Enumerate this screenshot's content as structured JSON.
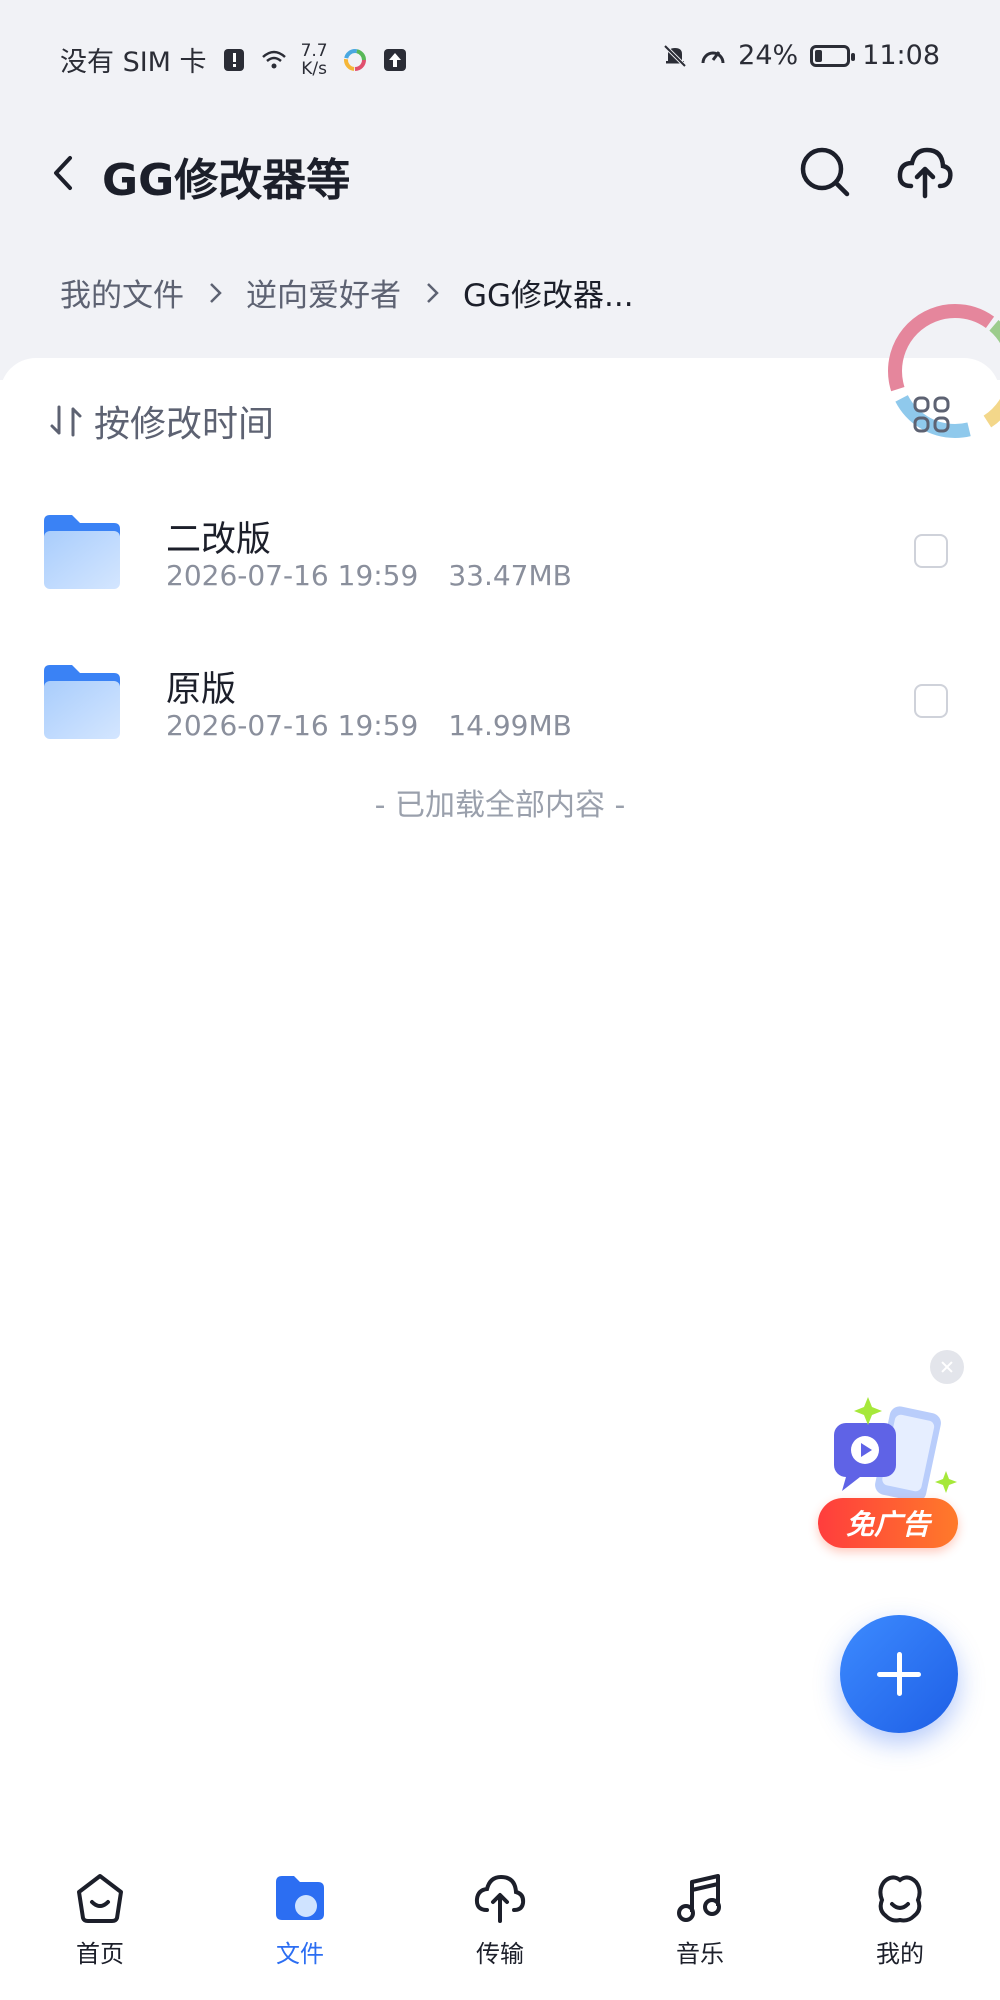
{
  "status_bar": {
    "carrier": "没有 SIM 卡",
    "net_speed_value": "7.7",
    "net_speed_unit": "K/s",
    "battery_percent": "24%",
    "battery_level": 0.24,
    "time": "11:08"
  },
  "header": {
    "title": "GG修改器等"
  },
  "breadcrumb": [
    {
      "label": "我的文件"
    },
    {
      "label": "逆向爱好者"
    },
    {
      "label": "GG修改器..."
    }
  ],
  "sort": {
    "label": "按修改时间"
  },
  "files": [
    {
      "name": "二改版",
      "date": "2026-07-16 19:59",
      "size": "33.47MB"
    },
    {
      "name": "原版",
      "date": "2026-07-16 19:59",
      "size": "14.99MB"
    }
  ],
  "footer_text": "- 已加载全部内容 -",
  "ad": {
    "badge": "免广告"
  },
  "nav": [
    {
      "label": "首页",
      "icon": "home-icon"
    },
    {
      "label": "文件",
      "icon": "file-icon"
    },
    {
      "label": "传输",
      "icon": "transfer-icon"
    },
    {
      "label": "音乐",
      "icon": "music-icon"
    },
    {
      "label": "我的",
      "icon": "profile-icon"
    }
  ],
  "colors": {
    "accent": "#2c6ef2",
    "background": "#f1f2f6"
  }
}
